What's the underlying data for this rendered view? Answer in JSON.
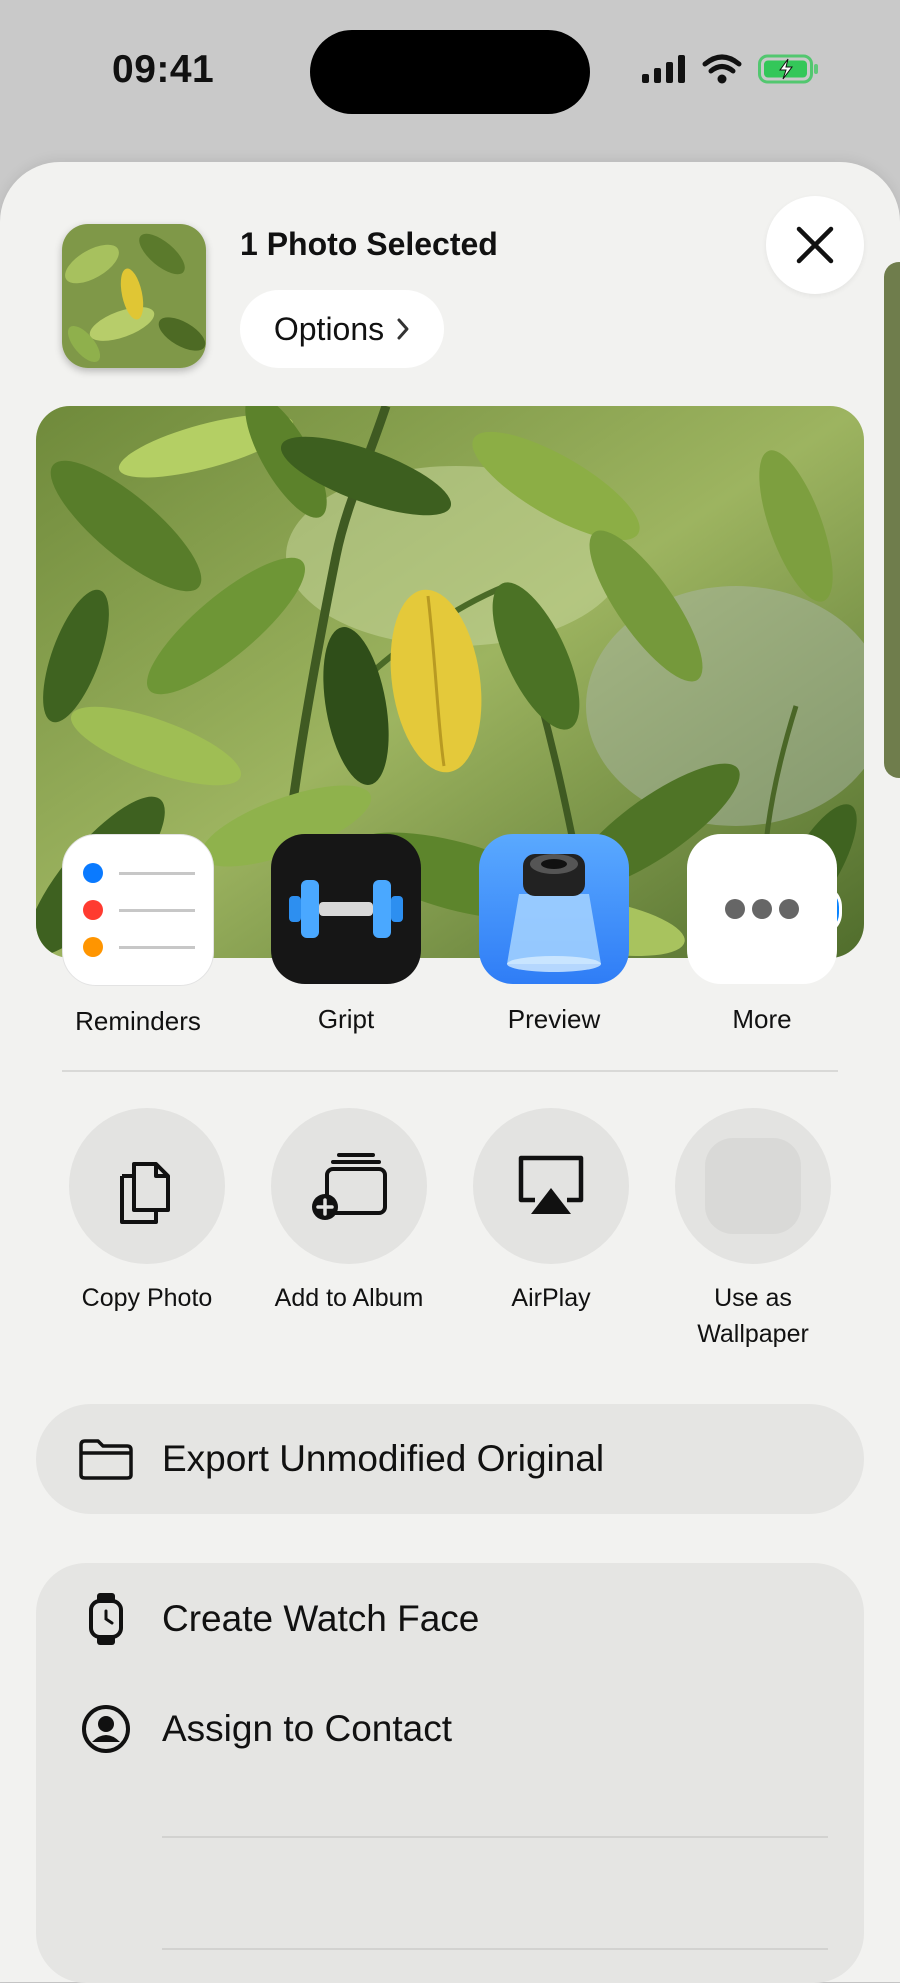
{
  "status": {
    "time": "09:41",
    "battery_color": "#34c759"
  },
  "header": {
    "title": "1 Photo Selected",
    "options_label": "Options"
  },
  "apps": [
    {
      "label": "Reminders",
      "icon": "reminders-icon"
    },
    {
      "label": "Gript",
      "icon": "gript-icon"
    },
    {
      "label": "Preview",
      "icon": "preview-icon"
    },
    {
      "label": "More",
      "icon": "more-icon"
    }
  ],
  "actions": [
    {
      "label": "Copy Photo",
      "icon": "copy-icon"
    },
    {
      "label": "Add to Album",
      "icon": "add-to-album-icon"
    },
    {
      "label": "AirPlay",
      "icon": "airplay-icon"
    },
    {
      "label": "Use as\nWallpaper",
      "icon": "wallpaper-icon"
    }
  ],
  "export": {
    "label": "Export Unmodified Original",
    "icon": "folder-icon"
  },
  "list": [
    {
      "label": "Create Watch Face",
      "icon": "watch-icon"
    },
    {
      "label": "Assign to Contact",
      "icon": "contact-icon"
    }
  ],
  "colors": {
    "accent": "#0a84ff",
    "sheet": "#f2f2f0"
  }
}
